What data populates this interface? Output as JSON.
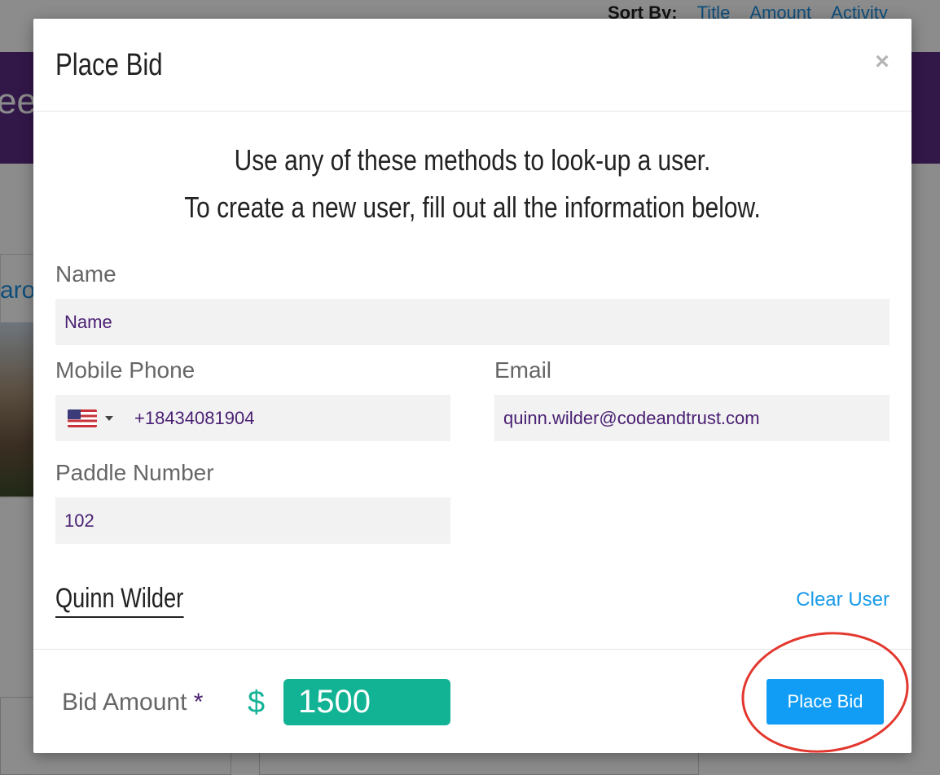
{
  "background": {
    "sort_label": "Sort By:",
    "sort_options": [
      "Title",
      "Amount",
      "Activity"
    ],
    "banner_text": "ee",
    "card_title": "aro."
  },
  "modal": {
    "title": "Place Bid",
    "close_glyph": "×",
    "intro_line1": "Use any of these methods to look-up a user.",
    "intro_line2": "To create a new user, fill out all the information below.",
    "fields": {
      "name": {
        "label": "Name",
        "placeholder": "Name",
        "value": ""
      },
      "phone": {
        "label": "Mobile Phone",
        "value": "+18434081904",
        "country_icon": "us-flag-icon"
      },
      "email": {
        "label": "Email",
        "value": "quinn.wilder@codeandtrust.com"
      },
      "paddle": {
        "label": "Paddle Number",
        "value": "102"
      }
    },
    "selected_user": "Quinn Wilder",
    "clear_user_label": "Clear User",
    "footer": {
      "bid_label": "Bid Amount",
      "required_marker": "*",
      "currency_symbol": "$",
      "bid_value": "1500",
      "submit_label": "Place Bid"
    }
  },
  "colors": {
    "accent_purple": "#5b2a86",
    "link_blue": "#1a9be8",
    "bid_green": "#12b394",
    "button_blue": "#119df5",
    "annotation_red": "#e3372e"
  }
}
